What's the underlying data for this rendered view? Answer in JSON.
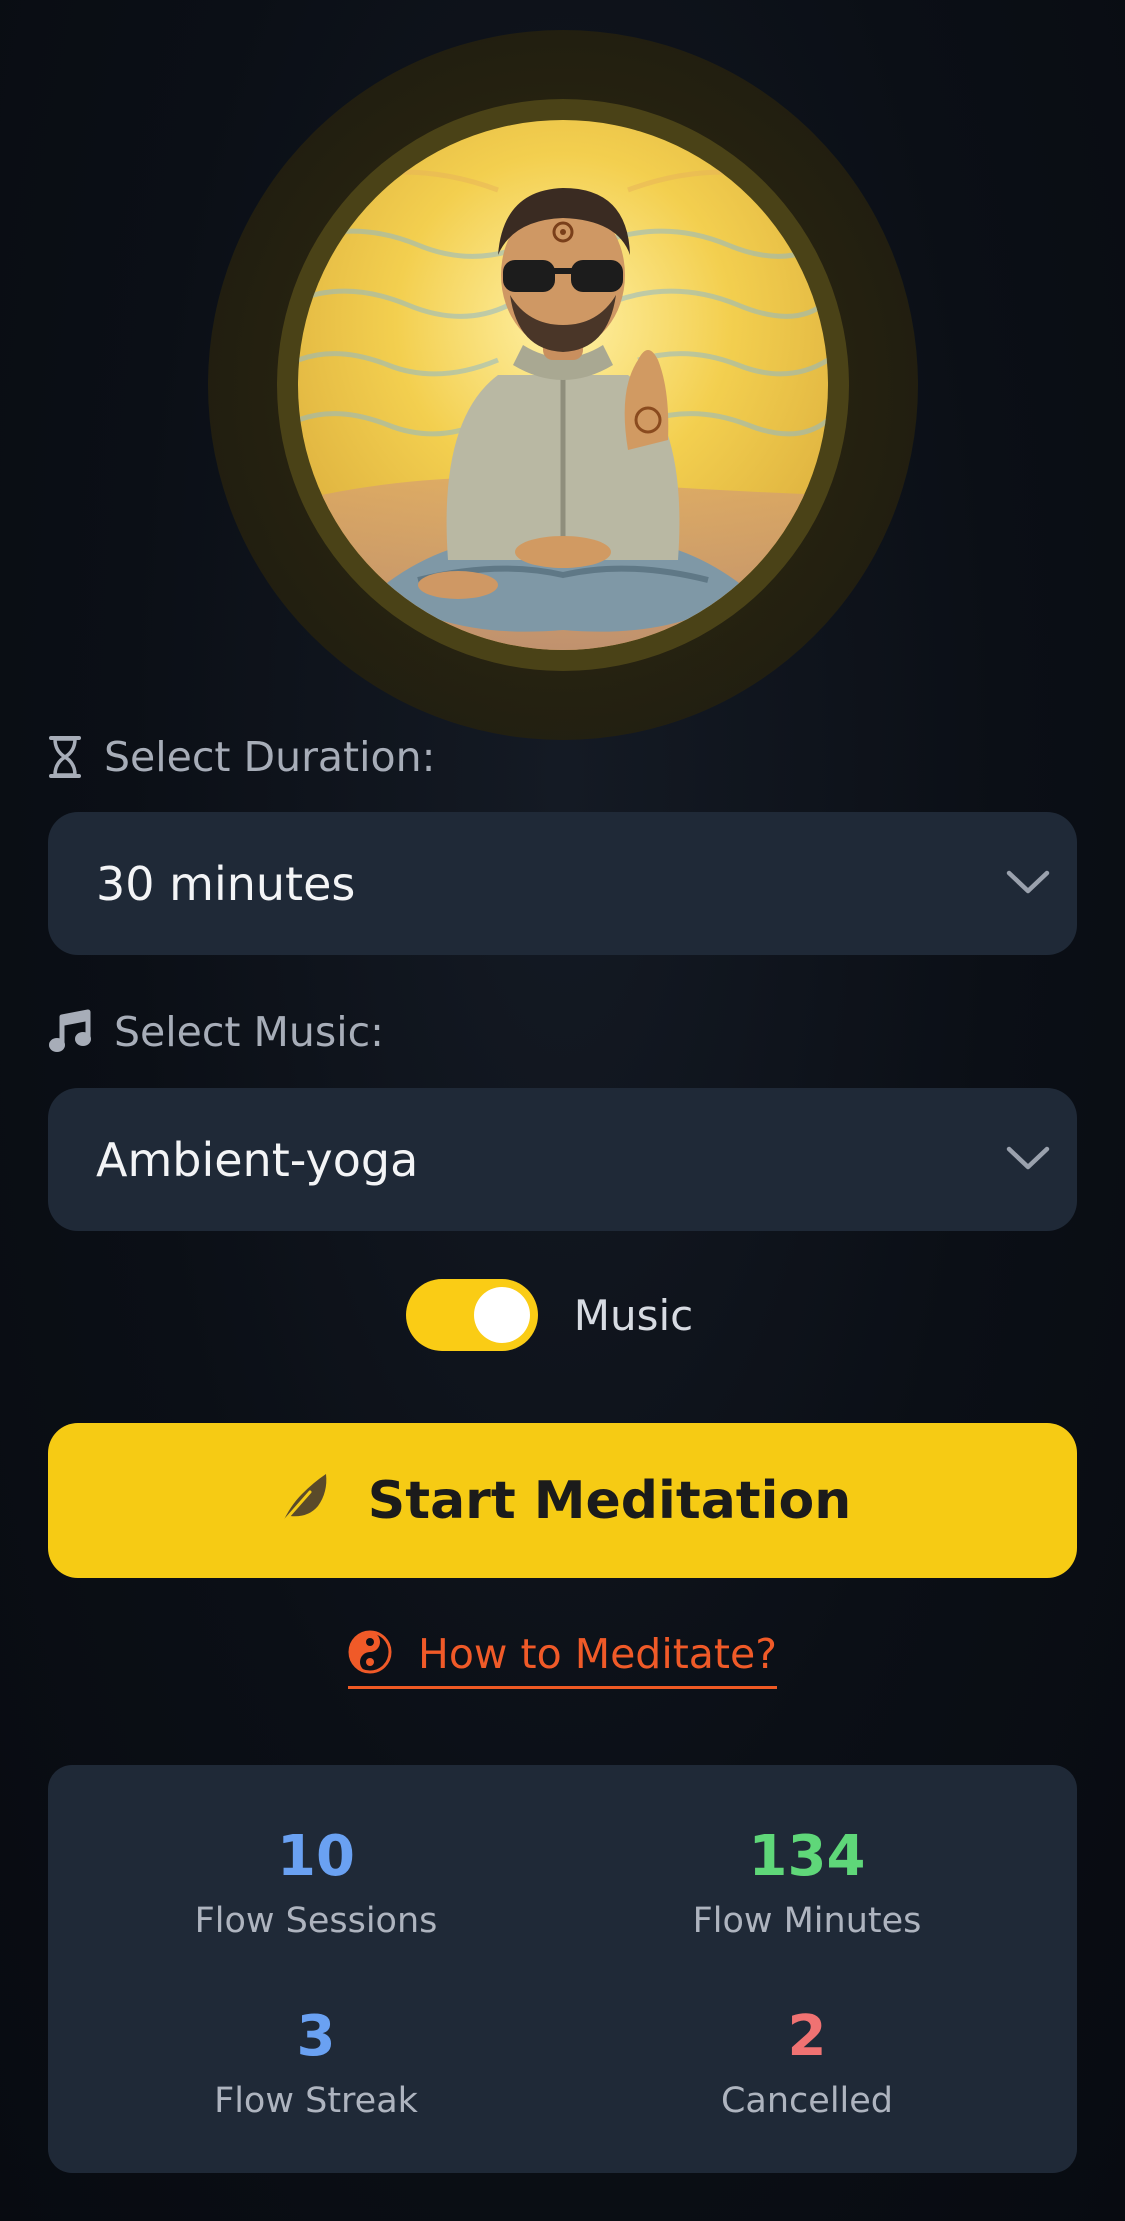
{
  "avatar": {
    "description_icon": "meditating-person-illustration"
  },
  "duration": {
    "label": "Select Duration:",
    "icon": "hourglass-icon",
    "selected": "30 minutes"
  },
  "music": {
    "label": "Select Music:",
    "icon": "music-note-icon",
    "selected": "Ambient-yoga",
    "toggle_label": "Music",
    "toggle_on": true
  },
  "start": {
    "label": "Start Meditation",
    "icon": "feather-icon"
  },
  "howto": {
    "label": "How to Meditate?",
    "icon": "yin-yang-icon"
  },
  "stats": {
    "sessions": {
      "value": "10",
      "label": "Flow Sessions"
    },
    "minutes": {
      "value": "134",
      "label": "Flow Minutes"
    },
    "streak": {
      "value": "3",
      "label": "Flow Streak"
    },
    "cancelled": {
      "value": "2",
      "label": "Cancelled"
    }
  },
  "colors": {
    "accent": "#f6cb14",
    "link": "#f05a28",
    "blue": "#6aa1f2",
    "green": "#5fd779",
    "red": "#f07272",
    "card": "#1f2937"
  }
}
